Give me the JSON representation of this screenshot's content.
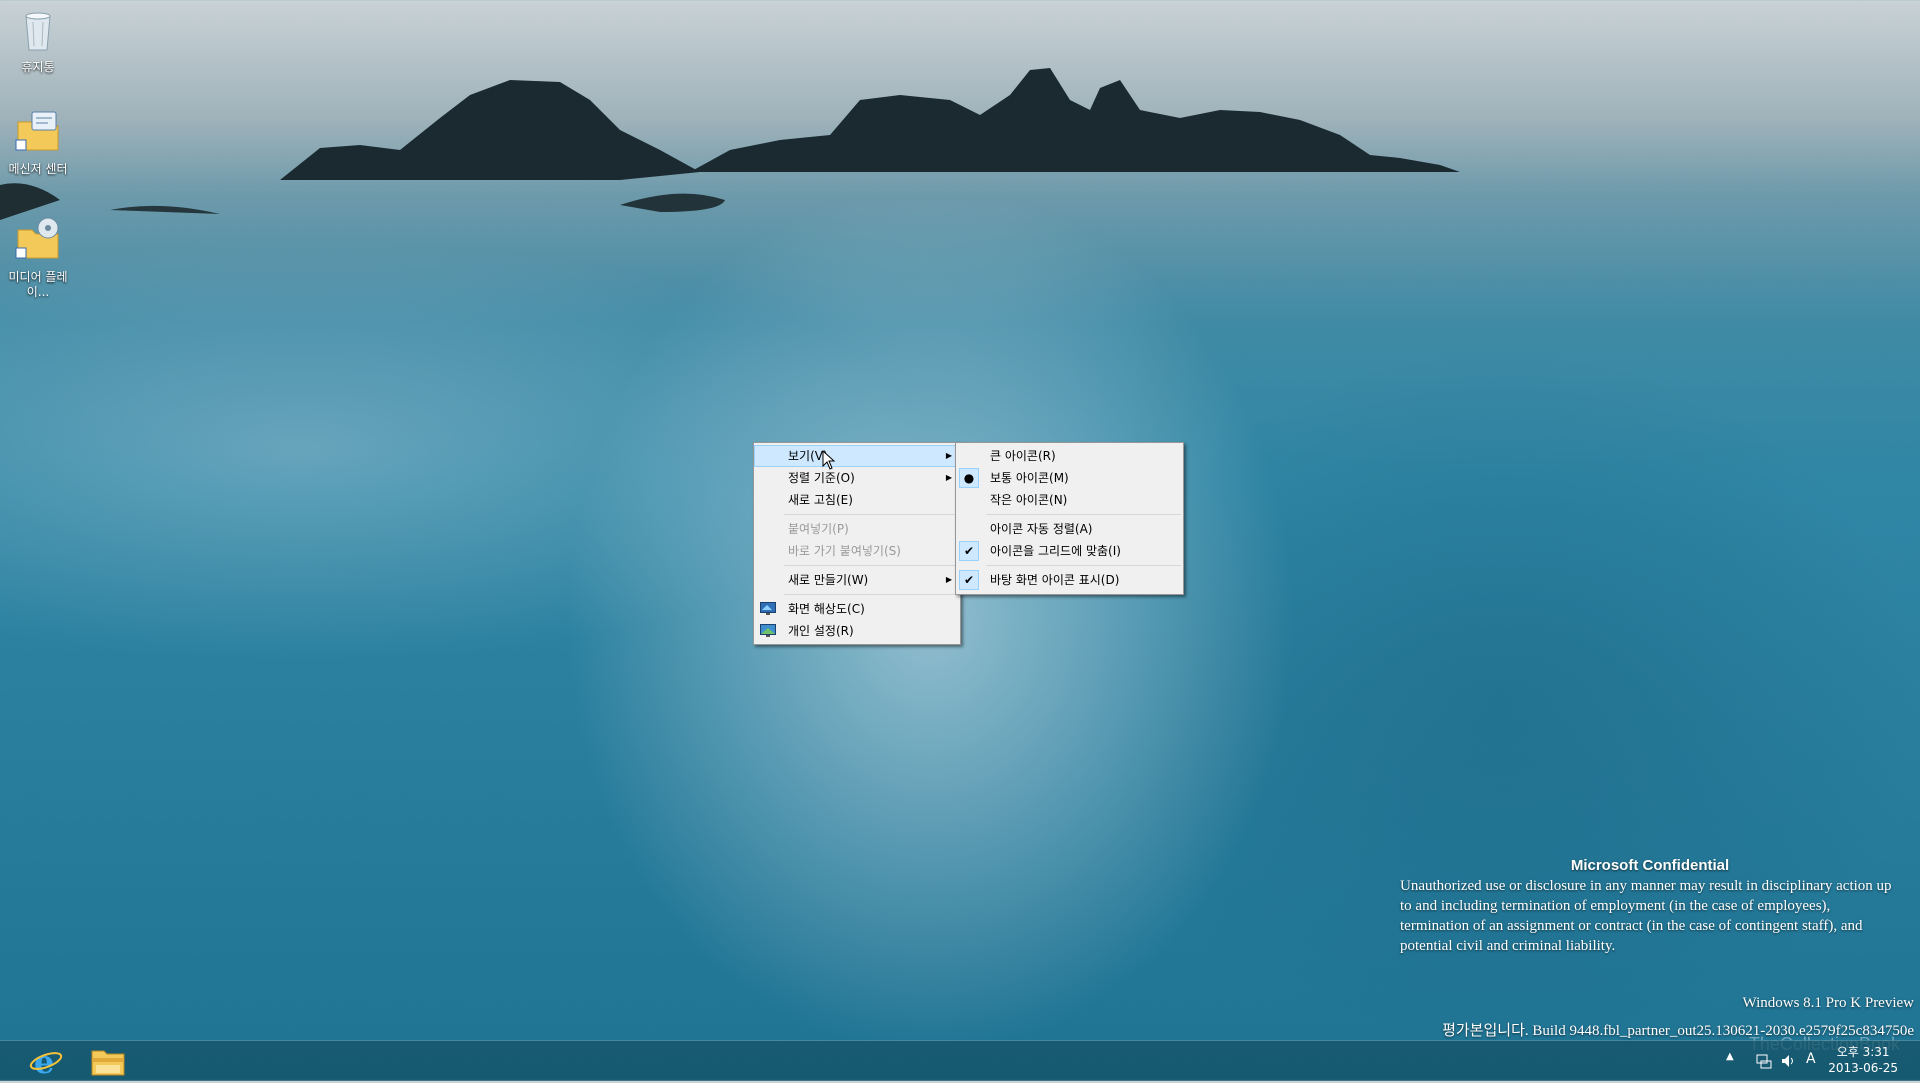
{
  "desktop": {
    "icons": [
      {
        "label": "휴지통",
        "icon": "recycle-bin-icon"
      },
      {
        "label": "메신저 센터",
        "icon": "messenger-center-folder-icon"
      },
      {
        "label": "미디어 플레이...",
        "icon": "media-player-folder-icon"
      }
    ]
  },
  "context_menu": {
    "items": [
      {
        "label": "보기(V)",
        "submenu": true,
        "highlighted": true
      },
      {
        "label": "정렬 기준(O)",
        "submenu": true
      },
      {
        "label": "새로 고침(E)"
      },
      {
        "label": "붙여넣기(P)",
        "disabled": true
      },
      {
        "label": "바로 가기 붙여넣기(S)",
        "disabled": true
      },
      {
        "label": "새로 만들기(W)",
        "submenu": true
      },
      {
        "label": "화면 해상도(C)",
        "icon": "screen-resolution-icon"
      },
      {
        "label": "개인 설정(R)",
        "icon": "personalize-icon"
      }
    ]
  },
  "view_submenu": {
    "items": [
      {
        "label": "큰 아이콘(R)"
      },
      {
        "label": "보통 아이콘(M)",
        "selected": true,
        "mark": "●"
      },
      {
        "label": "작은 아이콘(N)"
      },
      {
        "label": "아이콘 자동 정렬(A)"
      },
      {
        "label": "아이콘을 그리드에 맞춤(I)",
        "checked": true,
        "mark": "✔"
      },
      {
        "label": "바탕 화면 아이콘 표시(D)",
        "checked": true,
        "mark": "✔"
      }
    ]
  },
  "notice": {
    "title": "Microsoft Confidential",
    "body": "Unauthorized use or disclosure in any manner may result in disciplinary action up to and including termination of employment (in the case of employees), termination of an assignment or contract (in the case of contingent staff), and potential civil and criminal liability."
  },
  "build": {
    "edition": "Windows 8.1 Pro K Preview",
    "info": "평가본입니다. Build 9448.fbl_partner_out25.130621-2030.e2579f25c834750e"
  },
  "taskbar": {
    "pinned": [
      {
        "name": "Internet Explorer",
        "icon": "internet-explorer-icon"
      },
      {
        "name": "File Explorer",
        "icon": "file-explorer-icon"
      }
    ],
    "ime_indicator": "A",
    "time": "오후 3:31",
    "date": "2013-06-25"
  },
  "watermark": "TheCollectionBook",
  "colors": {
    "menu_bg": "#f0f0f0",
    "menu_highlight": "#cde8ff",
    "menu_highlight_border": "#99d1ff",
    "disabled_text": "#9a9a9a"
  }
}
